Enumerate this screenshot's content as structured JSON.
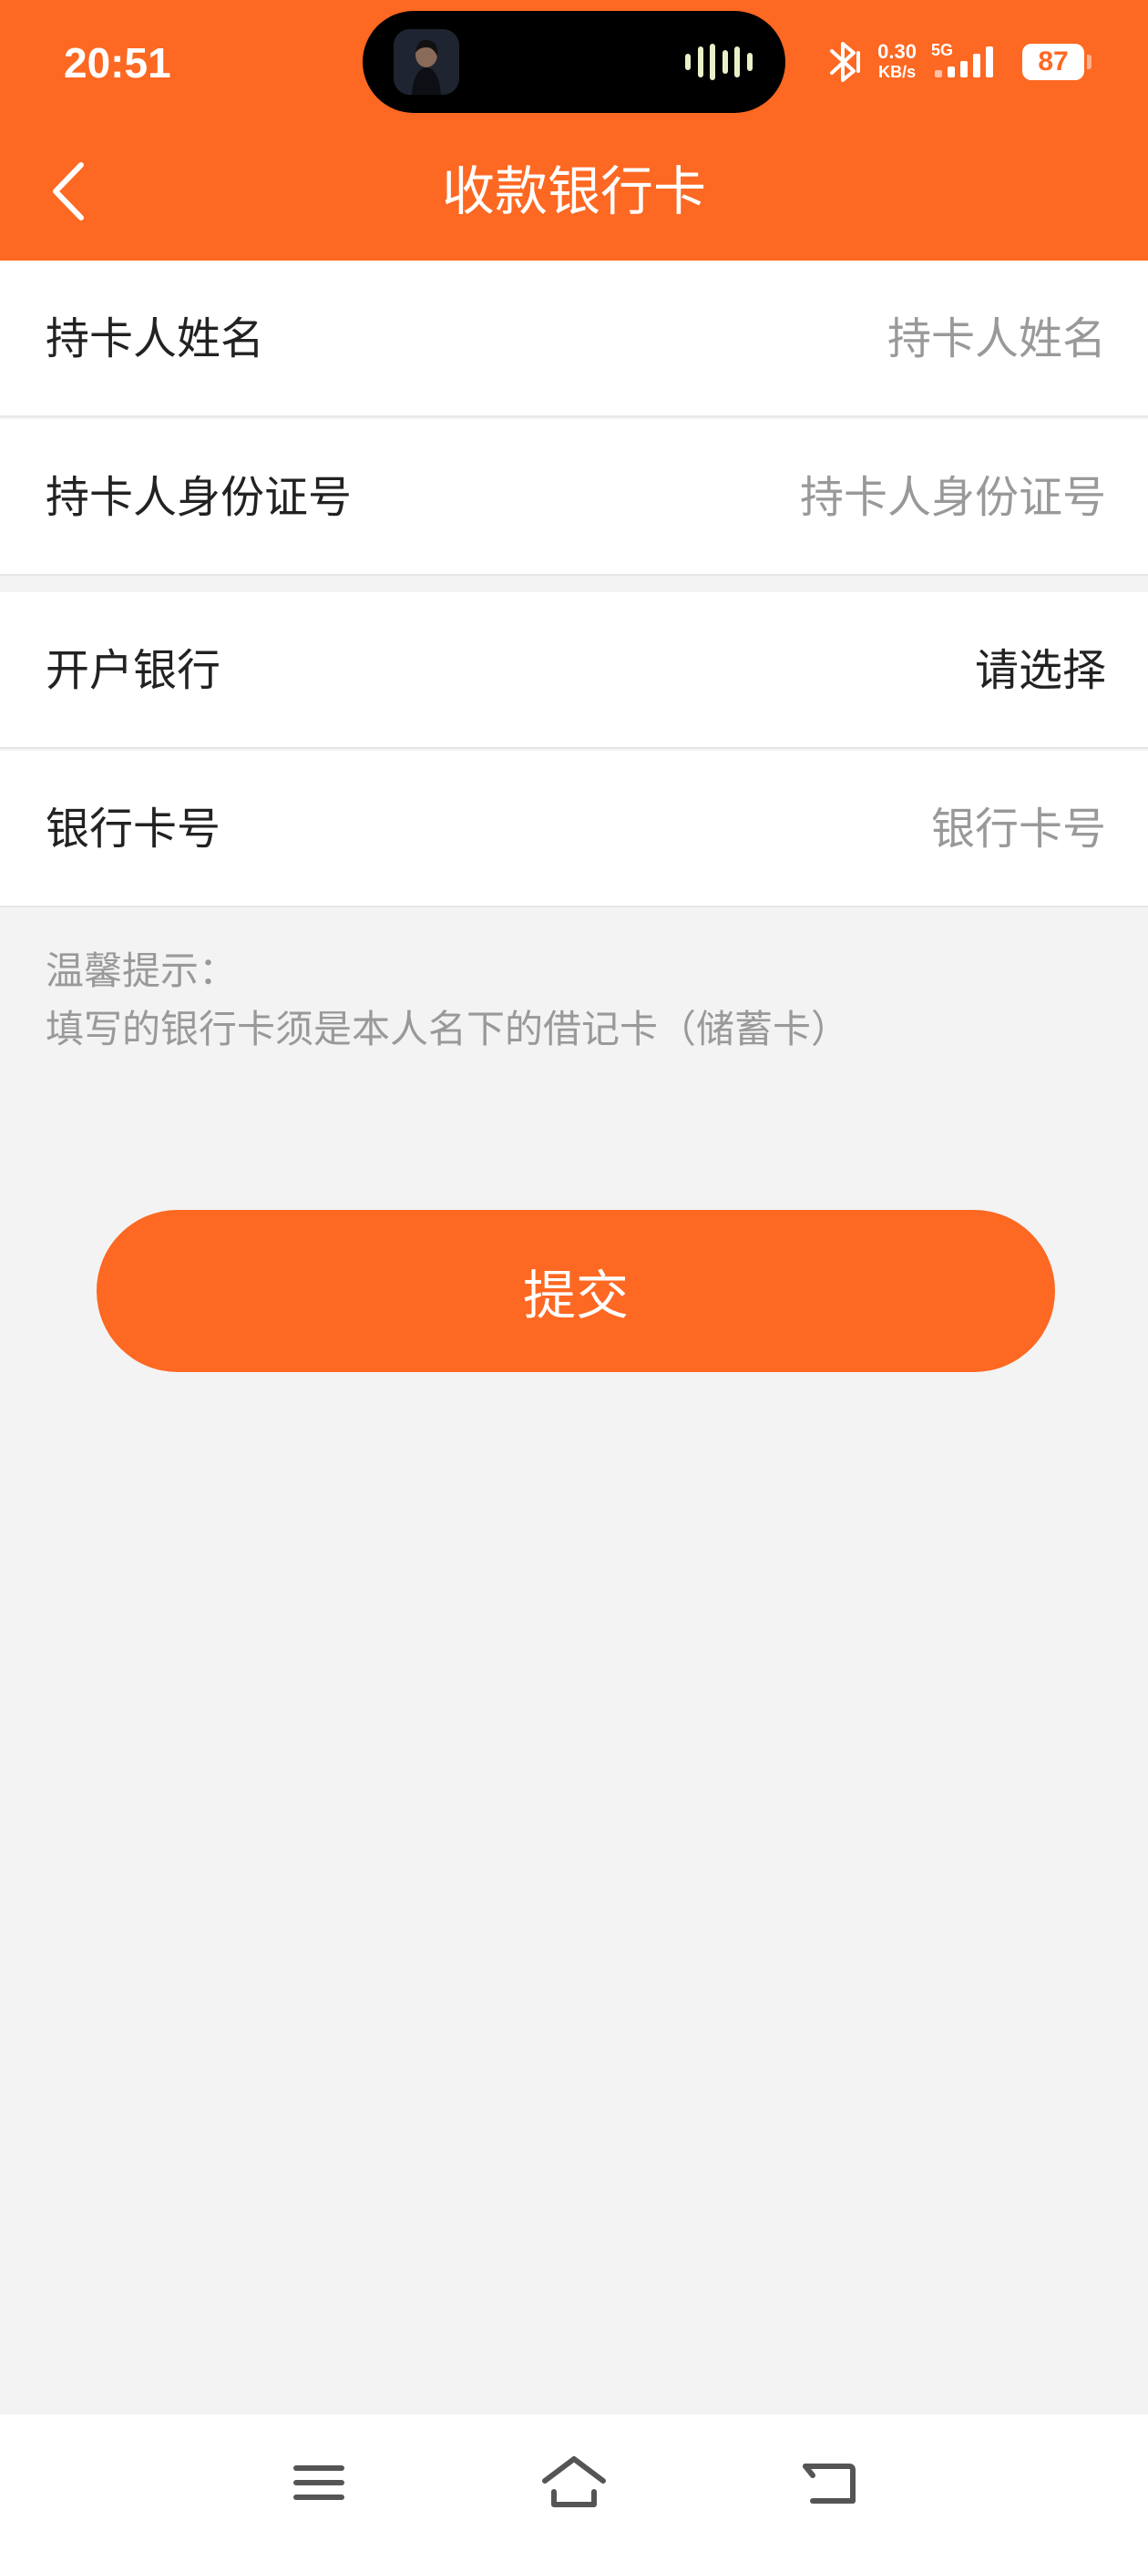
{
  "status_bar": {
    "time": "20:51",
    "net_speed": "0.30",
    "net_unit": "KB/s",
    "network": "5G",
    "battery": "87"
  },
  "header": {
    "title": "收款银行卡",
    "back_icon": "chevron-left-icon"
  },
  "form": {
    "name_label": "持卡人姓名",
    "name_placeholder": "持卡人姓名",
    "id_label": "持卡人身份证号",
    "id_placeholder": "持卡人身份证号",
    "bank_label": "开户银行",
    "bank_value": "请选择",
    "card_label": "银行卡号",
    "card_placeholder": "银行卡号"
  },
  "tip": {
    "title": "温馨提示：",
    "text": "填写的银行卡须是本人名下的借记卡（储蓄卡）"
  },
  "submit_label": "提交",
  "nav": {
    "menu_icon": "menu-icon",
    "home_icon": "home-icon",
    "back_icon": "back-icon"
  },
  "colors": {
    "accent": "#fd6822",
    "background": "#f3f3f3",
    "placeholder": "#999999"
  }
}
